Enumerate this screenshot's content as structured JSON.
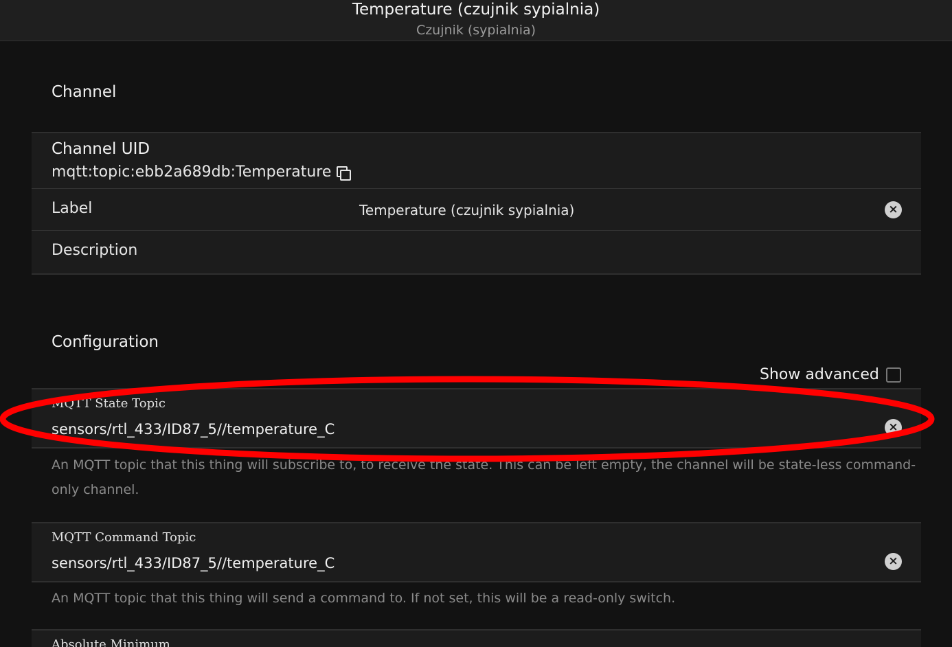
{
  "header": {
    "title": "Temperature (czujnik sypialnia)",
    "subtitle": "Czujnik (sypialnia)"
  },
  "channel_section": {
    "title": "Channel",
    "uid_label": "Channel UID",
    "uid_value": "mqtt:topic:ebb2a689db:Temperature",
    "label_label": "Label",
    "label_value": "Temperature (czujnik sypialnia)",
    "description_label": "Description"
  },
  "configuration": {
    "title": "Configuration",
    "show_advanced_label": "Show advanced",
    "fields": [
      {
        "label": "MQTT State Topic",
        "value": "sensors/rtl_433/ID87_5//temperature_C",
        "hint": "An MQTT topic that this thing will subscribe to, to receive the state. This can be left empty, the channel will be state-less command-only channel."
      },
      {
        "label": "MQTT Command Topic",
        "value": "sensors/rtl_433/ID87_5//temperature_C",
        "hint": "An MQTT topic that this thing will send a command to. If not set, this will be a read-only switch."
      },
      {
        "label": "Absolute Minimum"
      }
    ]
  },
  "colors": {
    "annotation": "#ff0000"
  },
  "icons": {
    "copy": "copy-icon",
    "clear": "clear-circle-x-icon"
  }
}
